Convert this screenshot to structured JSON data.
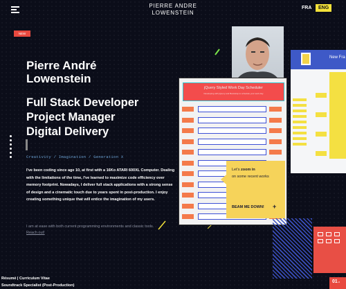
{
  "header": {
    "site_title_line1": "PIERRE ANDRE",
    "site_title_line2": "LOWENSTEIN",
    "lang_fra": "FRA",
    "lang_eng": "ENG"
  },
  "hero": {
    "badge": "NEW",
    "name_line1": "Pierre André",
    "name_line2": "Lowenstein",
    "roles": [
      "Full Stack Developer",
      "Project Manager",
      "Digital Delivery"
    ],
    "tagline": "Creativity / Imagination / Generation X",
    "bio": "I've been coding since age 10, at first with a 16Ko ATARI 600XL Computer. Dealing with the limitations of the time, I've learned to maximize code efficiency over memory footprint. Nowadays, I deliver full stack applications with a strong sense of design and a cinematic touch due to years spent in post-production. I enjoy creating something unique that will entice the imagination of my users.",
    "bio2_prefix": "I am at ease with both current programming environments and classic tools. ",
    "reach_out": "Reach out!"
  },
  "footer": {
    "line1": "Résumé | Curriculum Vitae",
    "line2": "Soundtrack Specialist (Post-Production)"
  },
  "scheduler": {
    "title": "jQuery Styled Work Day Scheduler",
    "subtitle": "Developing with jQuery and Bootstrap to schedule your work day",
    "rows": [
      "",
      "",
      "",
      "",
      "",
      "",
      "",
      "",
      "",
      "",
      ""
    ]
  },
  "zoom_card": {
    "title_prefix": "Let's ",
    "title_bold": "zoom in",
    "subtitle": "on some recent works",
    "cta": "BEAM ME DOWN!",
    "plus": "+"
  },
  "site_thumb": {
    "title": "New Fra"
  },
  "counter": {
    "value": "01",
    "suffix": ".o"
  },
  "colors": {
    "background": "#0b0d19",
    "accent_yellow": "#f4e23a",
    "accent_red": "#e8493f",
    "tagline_blue": "#6fa8dc"
  }
}
